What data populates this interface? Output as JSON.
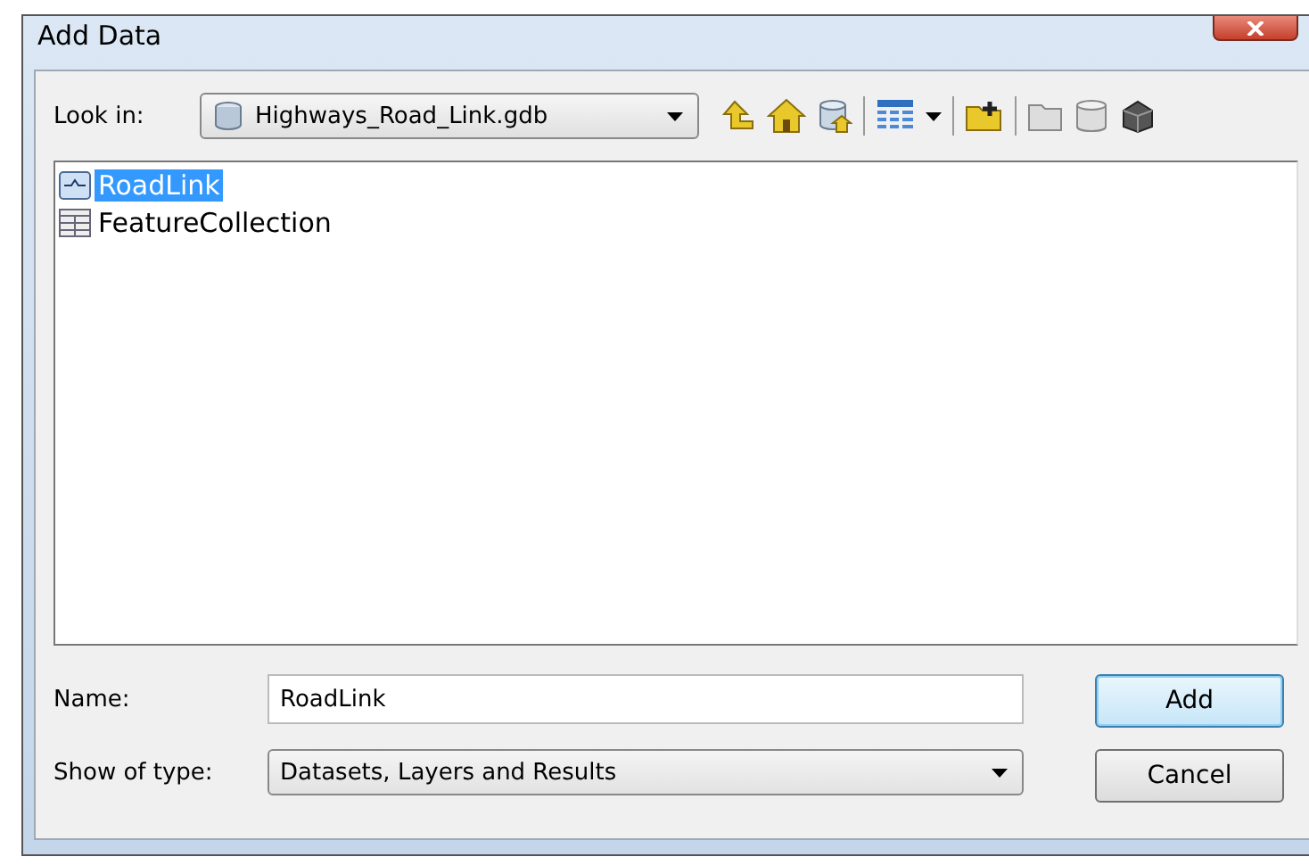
{
  "window": {
    "title": "Add Data"
  },
  "look_in": {
    "label": "Look in:",
    "value": "Highways_Road_Link.gdb"
  },
  "items": [
    {
      "label": "RoadLink",
      "kind": "line",
      "selected": true
    },
    {
      "label": "FeatureCollection",
      "kind": "table",
      "selected": false
    }
  ],
  "name": {
    "label": "Name:",
    "value": "RoadLink"
  },
  "type": {
    "label": "Show of type:",
    "value": "Datasets, Layers and Results"
  },
  "buttons": [
    {
      "label": "Add",
      "default": true
    },
    {
      "label": "Cancel",
      "default": false
    }
  ]
}
